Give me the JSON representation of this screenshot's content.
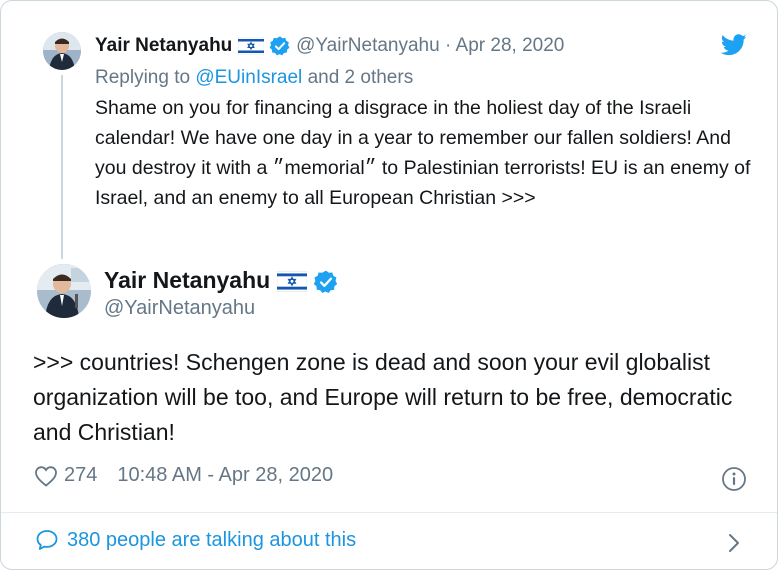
{
  "reply_tweet": {
    "author_name": "Yair Netanyahu",
    "handle": "@YairNetanyahu",
    "separator": "·",
    "date": "Apr 28, 2020",
    "replying_prefix": "Replying to",
    "replying_to": "@EUinIsrael",
    "replying_suffix": "and 2 others",
    "text": "Shame on you for financing a disgrace in the holiest day of the Israeli calendar! We have one day in a year to remember our fallen soldiers! And you destroy it with a ״memorial״ to Palestinian terrorists! EU is an enemy of Israel, and an enemy to all European Christian >>>"
  },
  "main_tweet": {
    "author_name": "Yair Netanyahu",
    "handle": "@YairNetanyahu",
    "text": ">>> countries! Schengen zone is dead and soon your evil globalist organization will be too, and Europe will return to be free, democratic and Christian!",
    "likes": "274",
    "timestamp": "10:48 AM - Apr 28, 2020"
  },
  "footer": {
    "talking_text": "380 people are talking about this"
  },
  "icons": {
    "brand": "twitter-bird-icon",
    "verified": "verified-badge-icon",
    "flag": "israel-flag-icon",
    "like": "heart-icon",
    "info": "info-icon",
    "talk": "speech-bubble-icon",
    "more": "chevron-right-icon"
  },
  "colors": {
    "accent": "#1b95e0",
    "verified": "#1da1f2",
    "muted": "#657786",
    "text": "#14171a",
    "border": "#ccd6dd"
  }
}
